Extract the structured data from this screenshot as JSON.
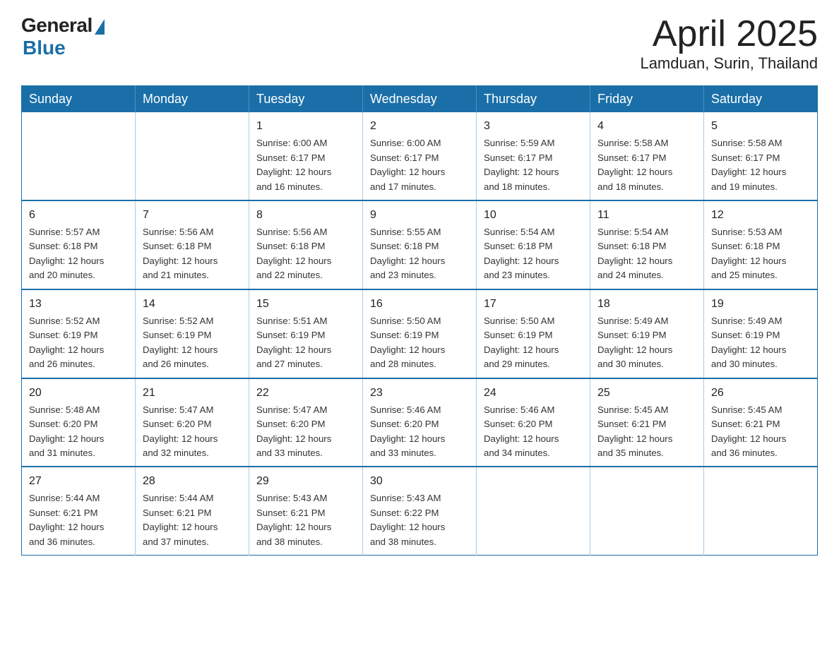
{
  "header": {
    "logo_general": "General",
    "logo_blue": "Blue",
    "month_title": "April 2025",
    "subtitle": "Lamduan, Surin, Thailand"
  },
  "weekdays": [
    "Sunday",
    "Monday",
    "Tuesday",
    "Wednesday",
    "Thursday",
    "Friday",
    "Saturday"
  ],
  "weeks": [
    [
      {
        "day": "",
        "info": ""
      },
      {
        "day": "",
        "info": ""
      },
      {
        "day": "1",
        "info": "Sunrise: 6:00 AM\nSunset: 6:17 PM\nDaylight: 12 hours\nand 16 minutes."
      },
      {
        "day": "2",
        "info": "Sunrise: 6:00 AM\nSunset: 6:17 PM\nDaylight: 12 hours\nand 17 minutes."
      },
      {
        "day": "3",
        "info": "Sunrise: 5:59 AM\nSunset: 6:17 PM\nDaylight: 12 hours\nand 18 minutes."
      },
      {
        "day": "4",
        "info": "Sunrise: 5:58 AM\nSunset: 6:17 PM\nDaylight: 12 hours\nand 18 minutes."
      },
      {
        "day": "5",
        "info": "Sunrise: 5:58 AM\nSunset: 6:17 PM\nDaylight: 12 hours\nand 19 minutes."
      }
    ],
    [
      {
        "day": "6",
        "info": "Sunrise: 5:57 AM\nSunset: 6:18 PM\nDaylight: 12 hours\nand 20 minutes."
      },
      {
        "day": "7",
        "info": "Sunrise: 5:56 AM\nSunset: 6:18 PM\nDaylight: 12 hours\nand 21 minutes."
      },
      {
        "day": "8",
        "info": "Sunrise: 5:56 AM\nSunset: 6:18 PM\nDaylight: 12 hours\nand 22 minutes."
      },
      {
        "day": "9",
        "info": "Sunrise: 5:55 AM\nSunset: 6:18 PM\nDaylight: 12 hours\nand 23 minutes."
      },
      {
        "day": "10",
        "info": "Sunrise: 5:54 AM\nSunset: 6:18 PM\nDaylight: 12 hours\nand 23 minutes."
      },
      {
        "day": "11",
        "info": "Sunrise: 5:54 AM\nSunset: 6:18 PM\nDaylight: 12 hours\nand 24 minutes."
      },
      {
        "day": "12",
        "info": "Sunrise: 5:53 AM\nSunset: 6:18 PM\nDaylight: 12 hours\nand 25 minutes."
      }
    ],
    [
      {
        "day": "13",
        "info": "Sunrise: 5:52 AM\nSunset: 6:19 PM\nDaylight: 12 hours\nand 26 minutes."
      },
      {
        "day": "14",
        "info": "Sunrise: 5:52 AM\nSunset: 6:19 PM\nDaylight: 12 hours\nand 26 minutes."
      },
      {
        "day": "15",
        "info": "Sunrise: 5:51 AM\nSunset: 6:19 PM\nDaylight: 12 hours\nand 27 minutes."
      },
      {
        "day": "16",
        "info": "Sunrise: 5:50 AM\nSunset: 6:19 PM\nDaylight: 12 hours\nand 28 minutes."
      },
      {
        "day": "17",
        "info": "Sunrise: 5:50 AM\nSunset: 6:19 PM\nDaylight: 12 hours\nand 29 minutes."
      },
      {
        "day": "18",
        "info": "Sunrise: 5:49 AM\nSunset: 6:19 PM\nDaylight: 12 hours\nand 30 minutes."
      },
      {
        "day": "19",
        "info": "Sunrise: 5:49 AM\nSunset: 6:19 PM\nDaylight: 12 hours\nand 30 minutes."
      }
    ],
    [
      {
        "day": "20",
        "info": "Sunrise: 5:48 AM\nSunset: 6:20 PM\nDaylight: 12 hours\nand 31 minutes."
      },
      {
        "day": "21",
        "info": "Sunrise: 5:47 AM\nSunset: 6:20 PM\nDaylight: 12 hours\nand 32 minutes."
      },
      {
        "day": "22",
        "info": "Sunrise: 5:47 AM\nSunset: 6:20 PM\nDaylight: 12 hours\nand 33 minutes."
      },
      {
        "day": "23",
        "info": "Sunrise: 5:46 AM\nSunset: 6:20 PM\nDaylight: 12 hours\nand 33 minutes."
      },
      {
        "day": "24",
        "info": "Sunrise: 5:46 AM\nSunset: 6:20 PM\nDaylight: 12 hours\nand 34 minutes."
      },
      {
        "day": "25",
        "info": "Sunrise: 5:45 AM\nSunset: 6:21 PM\nDaylight: 12 hours\nand 35 minutes."
      },
      {
        "day": "26",
        "info": "Sunrise: 5:45 AM\nSunset: 6:21 PM\nDaylight: 12 hours\nand 36 minutes."
      }
    ],
    [
      {
        "day": "27",
        "info": "Sunrise: 5:44 AM\nSunset: 6:21 PM\nDaylight: 12 hours\nand 36 minutes."
      },
      {
        "day": "28",
        "info": "Sunrise: 5:44 AM\nSunset: 6:21 PM\nDaylight: 12 hours\nand 37 minutes."
      },
      {
        "day": "29",
        "info": "Sunrise: 5:43 AM\nSunset: 6:21 PM\nDaylight: 12 hours\nand 38 minutes."
      },
      {
        "day": "30",
        "info": "Sunrise: 5:43 AM\nSunset: 6:22 PM\nDaylight: 12 hours\nand 38 minutes."
      },
      {
        "day": "",
        "info": ""
      },
      {
        "day": "",
        "info": ""
      },
      {
        "day": "",
        "info": ""
      }
    ]
  ]
}
